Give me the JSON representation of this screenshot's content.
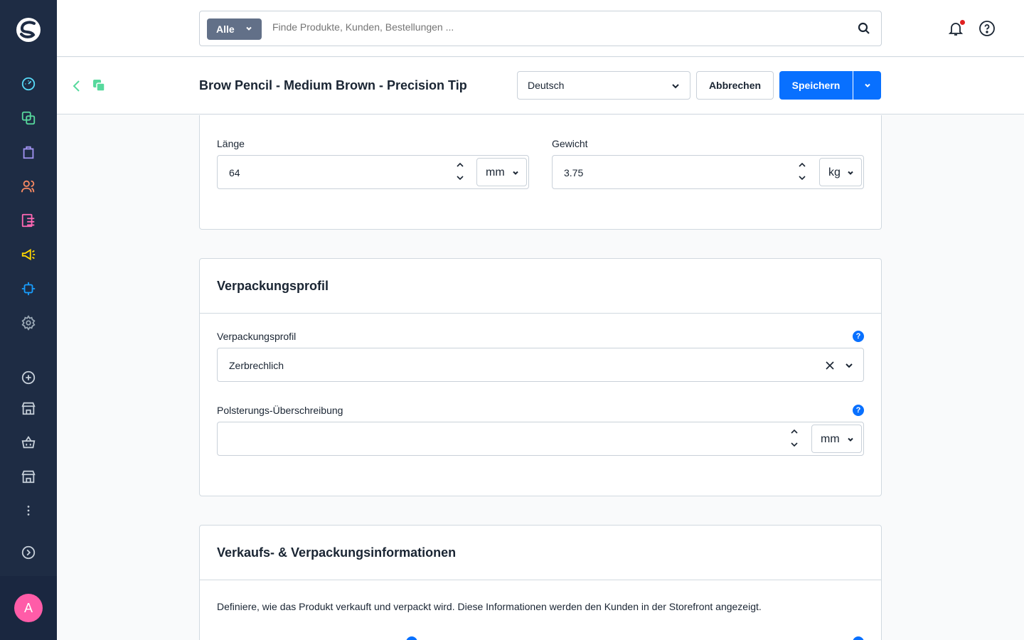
{
  "sidebar": {
    "avatar_initial": "A",
    "icons": [
      "dashboard-icon",
      "catalog-icon",
      "orders-icon",
      "customers-icon",
      "content-icon",
      "marketing-icon",
      "extensions-icon",
      "settings-icon",
      "add-channel-icon",
      "storefront-icon",
      "headless-icon",
      "storefront-2-icon",
      "more-icon",
      "expand-icon"
    ]
  },
  "topbar": {
    "search_type": "Alle",
    "search_placeholder": "Finde Produkte, Kunden, Bestellungen ..."
  },
  "smartbar": {
    "title": "Brow Pencil - Medium Brown - Precision Tip",
    "language": "Deutsch",
    "cancel_label": "Abbrechen",
    "save_label": "Speichern"
  },
  "measures": {
    "length_label": "Länge",
    "length_value": "64",
    "length_unit": "mm",
    "weight_label": "Gewicht",
    "weight_value": "3.75",
    "weight_unit": "kg"
  },
  "packaging": {
    "title": "Verpackungsprofil",
    "profile_label": "Verpackungsprofil",
    "profile_value": "Zerbrechlich",
    "padding_label": "Polsterungs-Überschreibung",
    "padding_value": "",
    "padding_unit": "mm",
    "help_glyph": "?"
  },
  "sales": {
    "title": "Verkaufs- & Verpackungsinformationen",
    "description": "Definiere, wie das Produkt verkauft und verpackt wird. Diese Informationen werden den Kunden in der Storefront angezeigt."
  },
  "colors": {
    "sidebar_bg": "#1e2c44",
    "primary": "#0870ff",
    "avatar": "#ff5ca8"
  }
}
